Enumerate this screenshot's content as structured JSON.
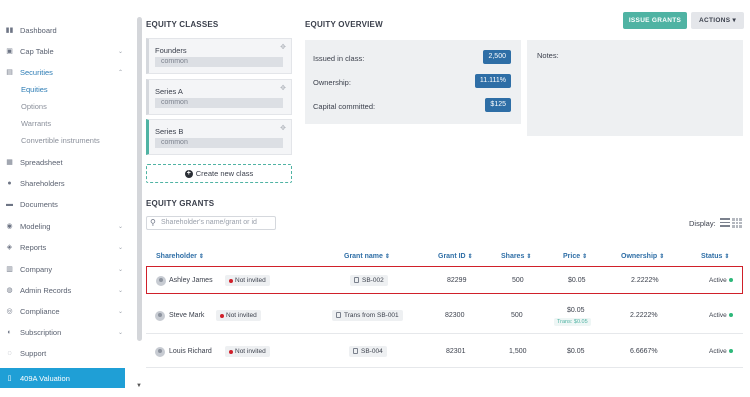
{
  "sidebar": {
    "items": [
      {
        "label": "Dashboard",
        "icon": "dashboard-icon",
        "glyph": "▮▮"
      },
      {
        "label": "Cap Table",
        "icon": "cap-table-icon",
        "glyph": "▣",
        "chevron": "⌄"
      },
      {
        "label": "Securities",
        "icon": "securities-icon",
        "glyph": "▤",
        "chevron": "⌃"
      },
      {
        "label": "Spreadsheet",
        "icon": "spreadsheet-icon",
        "glyph": "▦"
      },
      {
        "label": "Shareholders",
        "icon": "shareholders-icon",
        "glyph": "●"
      },
      {
        "label": "Documents",
        "icon": "documents-icon",
        "glyph": "▬"
      },
      {
        "label": "Modeling",
        "icon": "modeling-icon",
        "glyph": "◉",
        "chevron": "⌄"
      },
      {
        "label": "Reports",
        "icon": "reports-icon",
        "glyph": "◈",
        "chevron": "⌄"
      },
      {
        "label": "Company",
        "icon": "company-icon",
        "glyph": "▥",
        "chevron": "⌄"
      },
      {
        "label": "Admin Records",
        "icon": "admin-records-icon",
        "glyph": "◍",
        "chevron": "⌄"
      },
      {
        "label": "Compliance",
        "icon": "compliance-icon",
        "glyph": "◎",
        "chevron": "⌄"
      },
      {
        "label": "Subscription",
        "icon": "subscription-icon",
        "glyph": "◐",
        "chevron": "⌄"
      },
      {
        "label": "Support",
        "icon": "support-icon",
        "glyph": "◌"
      }
    ],
    "sub_items": [
      "Equities",
      "Options",
      "Warrants",
      "Convertible instruments"
    ],
    "valuation": {
      "label": "409A Valuation",
      "icon": "valuation-icon",
      "glyph": "▯"
    }
  },
  "equity_classes": {
    "title": "EQUITY CLASSES",
    "classes": [
      {
        "name": "Founders",
        "type": "common"
      },
      {
        "name": "Series A",
        "type": "common"
      },
      {
        "name": "Series B",
        "type": "common"
      }
    ],
    "create_label": "Create new class"
  },
  "overview": {
    "title": "EQUITY OVERVIEW",
    "issued_label": "Issued in class:",
    "issued_value": "2,500",
    "ownership_label": "Ownership:",
    "ownership_value": "11.111%",
    "capital_label": "Capital committed:",
    "capital_value": "$125",
    "notes_label": "Notes:"
  },
  "header_buttons": {
    "issue": "ISSUE GRANTS",
    "actions": "ACTIONS ▾"
  },
  "grants": {
    "title": "EQUITY GRANTS",
    "search_placeholder": "Shareholder's name/grant or id",
    "display_label": "Display:",
    "columns": [
      "Shareholder",
      "Grant name",
      "Grant ID",
      "Shares",
      "Price",
      "Ownership",
      "Status"
    ],
    "rows": [
      {
        "name": "Ashley James",
        "invite": "Not invited",
        "grant": "SB-002",
        "id": "82299",
        "shares": "500",
        "price": "$0.05",
        "price_sub": "",
        "ownership": "2.2222%",
        "status": "Active"
      },
      {
        "name": "Steve Mark",
        "invite": "Not invited",
        "grant": "Trans from SB-001",
        "id": "82300",
        "shares": "500",
        "price": "$0.05",
        "price_sub": "Trans: $0.05",
        "ownership": "2.2222%",
        "status": "Active"
      },
      {
        "name": "Louis Richard",
        "invite": "Not invited",
        "grant": "SB-004",
        "id": "82301",
        "shares": "1,500",
        "price": "$0.05",
        "price_sub": "",
        "ownership": "6.6667%",
        "status": "Active"
      }
    ]
  },
  "colors": {
    "accent": "#4fb3a3",
    "badge": "#2e6ea6",
    "highlight": "#d0202a",
    "valuation_bg": "#1f9fd6"
  }
}
